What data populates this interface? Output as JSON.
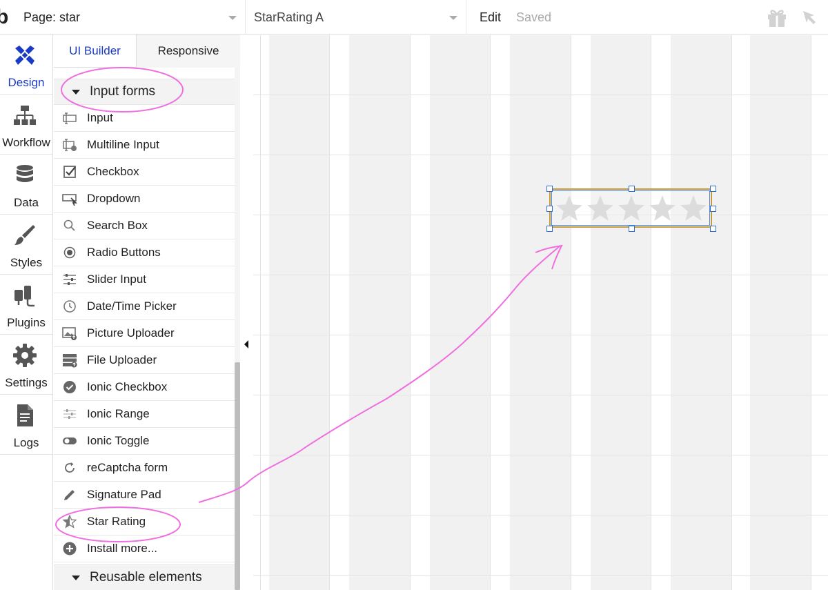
{
  "topbar": {
    "logo": "b",
    "page_label": "Page: star",
    "element_label": "StarRating A",
    "edit_label": "Edit",
    "saved_label": "Saved"
  },
  "leftnav": {
    "items": [
      {
        "label": "Design",
        "icon": "design-icon"
      },
      {
        "label": "Workflow",
        "icon": "workflow-icon"
      },
      {
        "label": "Data",
        "icon": "database-icon"
      },
      {
        "label": "Styles",
        "icon": "brush-icon"
      },
      {
        "label": "Plugins",
        "icon": "plug-icon"
      },
      {
        "label": "Settings",
        "icon": "gear-icon"
      },
      {
        "label": "Logs",
        "icon": "document-icon"
      }
    ]
  },
  "panel": {
    "tabs": [
      "UI Builder",
      "Responsive"
    ],
    "section_input_forms": "Input forms",
    "items": [
      {
        "label": "Input",
        "icon": "input-icon"
      },
      {
        "label": "Multiline Input",
        "icon": "multiline-input-icon"
      },
      {
        "label": "Checkbox",
        "icon": "checkbox-icon"
      },
      {
        "label": "Dropdown",
        "icon": "dropdown-icon"
      },
      {
        "label": "Search Box",
        "icon": "search-icon"
      },
      {
        "label": "Radio Buttons",
        "icon": "radio-icon"
      },
      {
        "label": "Slider Input",
        "icon": "slider-icon"
      },
      {
        "label": "Date/Time Picker",
        "icon": "clock-icon"
      },
      {
        "label": "Picture Uploader",
        "icon": "picture-upload-icon"
      },
      {
        "label": "File Uploader",
        "icon": "file-upload-icon"
      },
      {
        "label": "Ionic Checkbox",
        "icon": "ionic-checkbox-icon"
      },
      {
        "label": "Ionic Range",
        "icon": "ionic-range-icon"
      },
      {
        "label": "Ionic Toggle",
        "icon": "toggle-icon"
      },
      {
        "label": "reCaptcha form",
        "icon": "refresh-icon"
      },
      {
        "label": "Signature Pad",
        "icon": "pen-icon"
      },
      {
        "label": "Star Rating",
        "icon": "star-icon"
      },
      {
        "label": "Install more...",
        "icon": "plus-circle-icon"
      }
    ],
    "section_reusable": "Reusable elements"
  },
  "canvas": {
    "star_count": 5
  },
  "colors": {
    "accent": "#1a3bc5",
    "annotation": "#f06ee0",
    "star": "#dcdcdc"
  }
}
